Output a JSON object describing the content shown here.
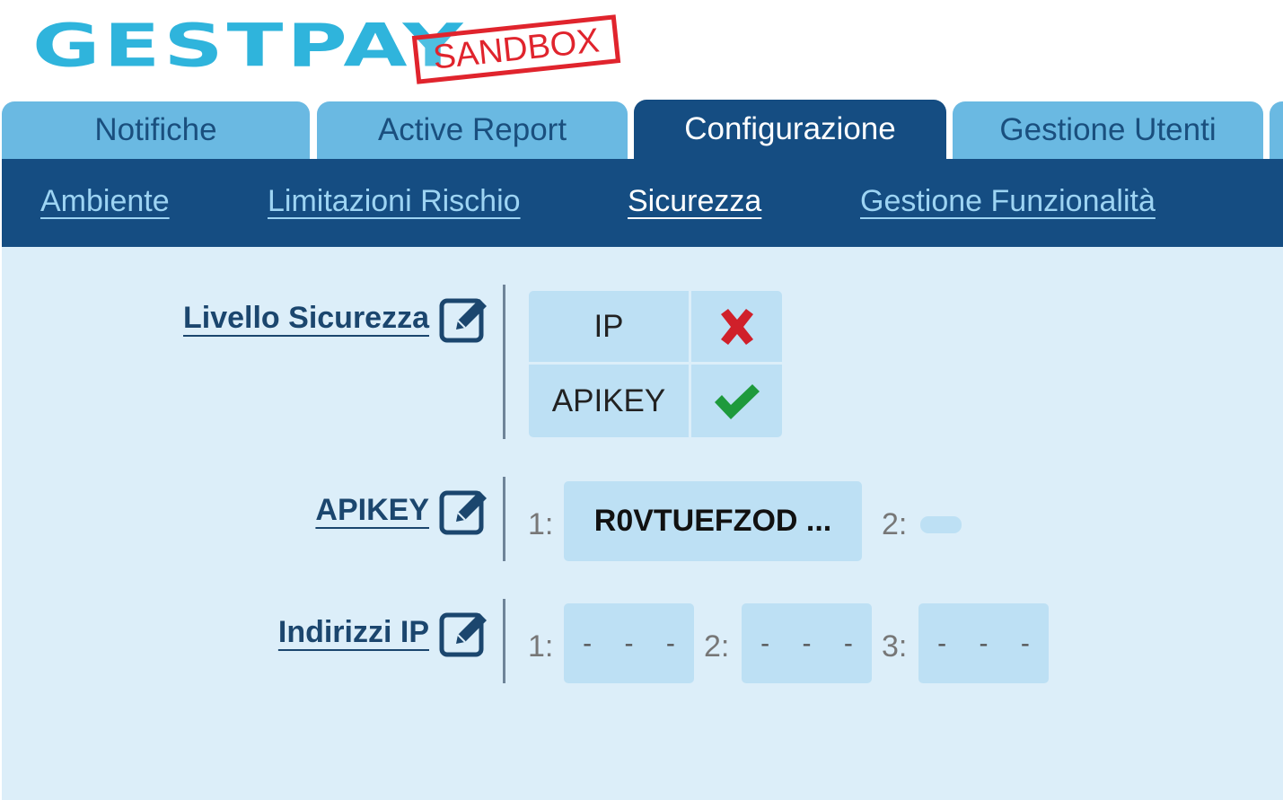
{
  "logo": {
    "text": "GESTPAY",
    "stamp": "SANDBOX"
  },
  "tabs": [
    {
      "label": "Notifiche"
    },
    {
      "label": "Active Report"
    },
    {
      "label": "Configurazione",
      "active": true
    },
    {
      "label": "Gestione Utenti"
    }
  ],
  "subnav": [
    {
      "label": "Ambiente"
    },
    {
      "label": "Limitazioni Rischio"
    },
    {
      "label": "Sicurezza",
      "current": true
    },
    {
      "label": "Gestione Funzionalità"
    }
  ],
  "security_level": {
    "label": "Livello Sicurezza",
    "rows": [
      {
        "name": "IP",
        "enabled": false,
        "icon": "cross-icon"
      },
      {
        "name": "APIKEY",
        "enabled": true,
        "icon": "check-icon"
      }
    ]
  },
  "apikey": {
    "label": "APIKEY",
    "slots": [
      {
        "index": "1:",
        "value": "R0VTUEFZOD ..."
      },
      {
        "index": "2:",
        "value": ""
      }
    ]
  },
  "ip_addresses": {
    "label": "Indirizzi IP",
    "slots": [
      {
        "index": "1:",
        "value": "- - -"
      },
      {
        "index": "2:",
        "value": "- - -"
      },
      {
        "index": "3:",
        "value": "- - -"
      }
    ]
  },
  "colors": {
    "logo": "#2fb4dc",
    "stamp": "#e0242d",
    "nav_dark": "#154d82",
    "tab_light": "#6ab9e2",
    "content_bg": "#dceef9",
    "cell_bg": "#bde0f4",
    "cross": "#d0202a",
    "check": "#1e9a3c"
  }
}
